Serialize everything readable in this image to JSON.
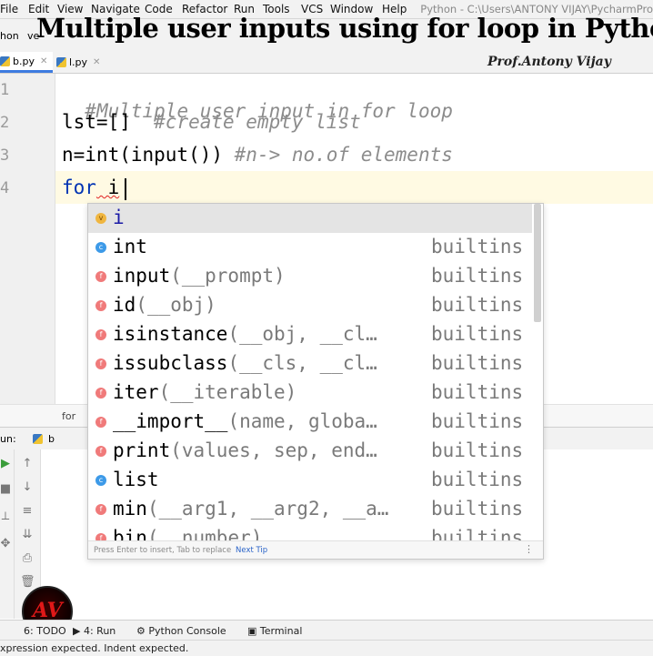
{
  "menubar": {
    "items": [
      "File",
      "Edit",
      "View",
      "Navigate",
      "Code",
      "Refactor",
      "Run",
      "Tools",
      "VCS",
      "Window",
      "Help"
    ],
    "window_title": "Python - C:\\Users\\ANTONY VIJAY\\PycharmPro"
  },
  "navbar": {
    "project": "hon",
    "crumb": "ve"
  },
  "overlay": {
    "title": "Multiple user inputs using for loop in Python",
    "author": "Prof.Antony Vijay"
  },
  "tabs": [
    {
      "label": "b.py"
    },
    {
      "label": "l.py"
    }
  ],
  "editor": {
    "line_numbers": [
      "1",
      "2",
      "3",
      "4"
    ],
    "line1_comment": "#Multiple user input in for loop",
    "line2_code": "lst=[]  ",
    "line2_comment": "#create empty list",
    "line3_code": "n=int(input()) ",
    "line3_comment": "#n-> no.of elements",
    "line4_kw": "for",
    "line4_rest": " i",
    "breadcrumb": "for"
  },
  "completion": {
    "items": [
      {
        "kind": "v",
        "name": "i",
        "params": "",
        "source": ""
      },
      {
        "kind": "c",
        "name": "int",
        "params": "",
        "source": "builtins"
      },
      {
        "kind": "f",
        "name": "input",
        "params": "(__prompt)",
        "source": "builtins"
      },
      {
        "kind": "f",
        "name": "id",
        "params": "(__obj)",
        "source": "builtins"
      },
      {
        "kind": "f",
        "name": "isinstance",
        "params": "(__obj, __cl…",
        "source": "builtins"
      },
      {
        "kind": "f",
        "name": "issubclass",
        "params": "(__cls, __cl…",
        "source": "builtins"
      },
      {
        "kind": "f",
        "name": "iter",
        "params": "(__iterable)",
        "source": "builtins"
      },
      {
        "kind": "f",
        "name": "__import__",
        "params": "(name, globa…",
        "source": "builtins"
      },
      {
        "kind": "f",
        "name": "print",
        "params": "(values, sep, end…",
        "source": "builtins"
      },
      {
        "kind": "c",
        "name": "list",
        "params": "",
        "source": "builtins"
      },
      {
        "kind": "f",
        "name": "min",
        "params": "(__arg1, __arg2, __a…",
        "source": "builtins"
      },
      {
        "kind": "f",
        "name": "bin",
        "params": "(__number)",
        "source": "builtins"
      }
    ],
    "footer_hint": "Press Enter to insert, Tab to replace",
    "footer_tip": "Next Tip",
    "footer_more": "⋮"
  },
  "run_panel": {
    "label": "un:",
    "tab": "b"
  },
  "bottom_tools": [
    "6: TODO",
    "4: Run",
    "Python Console",
    "Terminal"
  ],
  "status": {
    "message": "xpression expected. Indent expected."
  },
  "logo": {
    "text": "AV"
  },
  "icons": {
    "kind_v": "variable-icon",
    "kind_c": "class-icon",
    "kind_f": "function-icon"
  }
}
